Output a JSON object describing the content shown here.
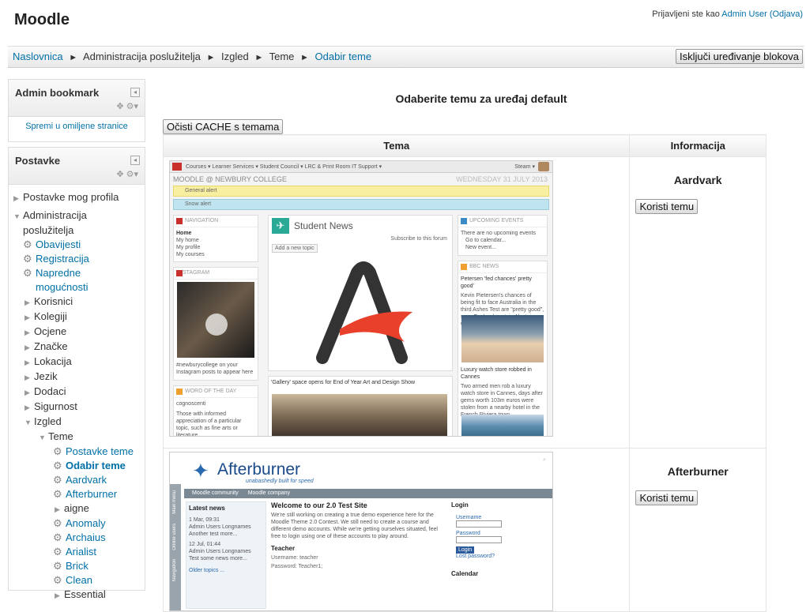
{
  "header": {
    "site_title": "Moodle",
    "login_prefix": "Prijavljeni ste kao",
    "login_user": "Admin User",
    "logout": "(Odjava)"
  },
  "breadcrumb": {
    "items": [
      "Naslovnica",
      "Administracija poslužitelja",
      "Izgled",
      "Teme",
      "Odabir teme"
    ],
    "separator": "►"
  },
  "edit_button": "Isključi uređivanje blokova",
  "admin_bookmark": {
    "title": "Admin bookmark",
    "link": "Spremi u omiljene stranice"
  },
  "settings_block": {
    "title": "Postavke",
    "my_profile": "Postavke mog profila",
    "admin": "Administracija poslužitelja",
    "admin_line1": "Administracija",
    "admin_line2": "poslužitelja",
    "items": {
      "obavijesti": "Obavijesti",
      "registracija": "Registracija",
      "napredne_1": "Napredne",
      "napredne_2": "mogućnosti",
      "korisnici": "Korisnici",
      "kolegiji": "Kolegiji",
      "ocjene": "Ocjene",
      "znacke": "Značke",
      "lokacija": "Lokacija",
      "jezik": "Jezik",
      "dodaci": "Dodaci",
      "sigurnost": "Sigurnost",
      "izgled": "Izgled",
      "teme": "Teme",
      "postavke_teme": "Postavke teme",
      "odabir_teme": "Odabir teme",
      "aardvark": "Aardvark",
      "afterburner": "Afterburner",
      "aigne": "aigne",
      "anomaly": "Anomaly",
      "archaius": "Archaius",
      "arialist": "Arialist",
      "brick": "Brick",
      "clean": "Clean",
      "essential": "Essential"
    }
  },
  "main": {
    "heading": "Odaberite temu za uređaj default",
    "cache_button": "Očisti CACHE s temama",
    "columns": [
      "Tema",
      "Informacija"
    ],
    "use_button": "Koristi temu",
    "themes": [
      {
        "name": "Aardvark",
        "preview": {
          "top_links": "Courses ▾    Learner Services ▾    Student Council ▾    LRC & Print Room    IT Support ▾",
          "user": "Steam ▾",
          "site": "MOODLE @ NEWBURY COLLEGE",
          "date": "WEDNESDAY 31 JULY 2013",
          "alert1": "General alert",
          "alert2": "Snow alert",
          "nav_title": "NAVIGATION",
          "nav_items": [
            "Home",
            "My home",
            "My profile",
            "My courses"
          ],
          "instagram": "INSTAGRAM",
          "instagram_caption": "#newburycollege on your Instagram posts to appear here",
          "news_title": "Student News",
          "subscribe": "Subscribe to this forum",
          "add_topic": "Add a new topic",
          "gallery": "'Gallery' space opens for End of Year Art and Design Show",
          "word_title": "WORD OF THE DAY",
          "word": "cognoscenti",
          "word_def": "Those with informed appreciation of a particular topic, such as fine arts or literature.",
          "events_title": "UPCOMING EVENTS",
          "events_text": "There are no upcoming events",
          "go_calendar": "Go to calendar...",
          "new_event": "New event...",
          "bbc_title": "BBC NEWS",
          "bbc_head": "Petersen 'fed chances' pretty good'",
          "bbc_text": "Kevin Pietersen's chances of being fit to face Australia in the third Ashes Test are \"pretty good\", says England captain Alastair Cook.",
          "bbc_head2": "Luxury watch store robbed in Cannes",
          "bbc_text2": "Two armed men rob a luxury watch store in Cannes, days after gems worth 103m euros were stolen from a nearby hotel in the French Riviera town."
        }
      },
      {
        "name": "Afterburner",
        "preview": {
          "brand": "Afterburner",
          "tagline": "unabashedly built for speed",
          "nav": [
            "Moodle community",
            "Moodle company"
          ],
          "side_tabs": [
            "Main menu",
            "Online users",
            "Navigation"
          ],
          "latest_news": "Latest news",
          "news1": "1 Mar, 09:31",
          "news1_author": "Admin Users Longnames",
          "news1_text": "Another test more...",
          "news2": "12 Jul, 01:44",
          "news2_author": "Admin Users Longnames",
          "news2_text": "Test some news more...",
          "older": "Older topics ...",
          "welcome": "Welcome to our 2.0 Test Site",
          "welcome_text": "We're still working on creating a true demo experience here for the Moodle Theme 2.0 Contest. We still need to create a course and different demo accounts. While we're getting ourselves situated, feel free to login using one of these accounts to play around.",
          "teacher": "Teacher",
          "username": "Username: teacher",
          "password": "Password: Teacher1;",
          "login": "Login",
          "user_label": "Username",
          "pass_label": "Password",
          "login_btn": "Login",
          "lost": "Lost password?",
          "calendar": "Calendar"
        }
      }
    ]
  },
  "colors": {
    "link": "#0070a8",
    "alert_yellow": "#f8efa0",
    "alert_blue": "#bfe3ef",
    "news_teal": "#2aaa96",
    "afterburner_blue": "#1a4a8a"
  }
}
